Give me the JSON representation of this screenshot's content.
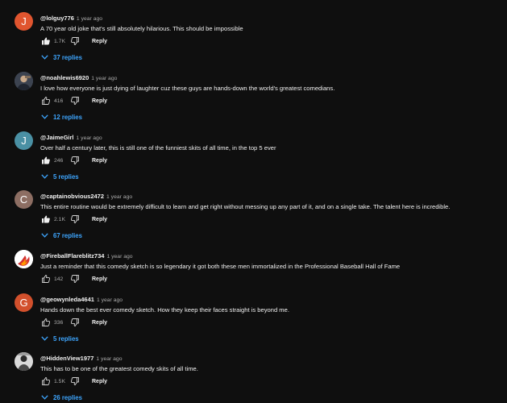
{
  "reply_label": "Reply",
  "colors": {
    "background": "#0f0f0f",
    "link": "#3ea6ff",
    "muted": "#aaaaaa"
  },
  "comments": [
    {
      "author": "@lolguy776",
      "time": "1 year ago",
      "text": "A 70 year old joke that's still absolutely hilarious. This should be impossible",
      "likes": "1.7K",
      "liked": true,
      "replies": "37 replies",
      "avatar_letter": "J",
      "avatar_color": "#e0552f"
    },
    {
      "author": "@noahlewis6920",
      "time": "1 year ago",
      "text": "I love how everyone is just dying of laughter cuz these guys are hands-down the world's greatest comedians.",
      "likes": "416",
      "liked": false,
      "replies": "12 replies",
      "avatar_letter": "",
      "avatar_color": "#4a4f5a"
    },
    {
      "author": "@JaimeGirl",
      "time": "1 year ago",
      "text": "Over half a century later, this is still one of the funniest skits of all time, in the top 5 ever",
      "likes": "246",
      "liked": true,
      "replies": "5 replies",
      "avatar_letter": "J",
      "avatar_color": "#4a90a4"
    },
    {
      "author": "@captainobvious2472",
      "time": "1 year ago",
      "text": "This entire routine would be extremely difficult to learn and get right without messing up any part of it, and on a single take. The talent here is incredible.",
      "likes": "2.1K",
      "liked": true,
      "replies": "67 replies",
      "avatar_letter": "C",
      "avatar_color": "#8d6e63"
    },
    {
      "author": "@FireballFlareblitz734",
      "time": "1 year ago",
      "text": "Just a reminder that this comedy sketch is so legendary it got both these men immortalized in the Professional Baseball Hall of Fame",
      "likes": "142",
      "liked": false,
      "replies": "",
      "avatar_letter": "",
      "avatar_color": "#ffffff"
    },
    {
      "author": "@geowynleda4641",
      "time": "1 year ago",
      "text": "Hands down the best ever comedy sketch.  How they keep their faces straight is beyond me.",
      "likes": "336",
      "liked": false,
      "replies": "5 replies",
      "avatar_letter": "G",
      "avatar_color": "#d2502c"
    },
    {
      "author": "@HiddenView1977",
      "time": "1 year ago",
      "text": "This has to be one of the greatest comedy skits of all time.",
      "likes": "1.5K",
      "liked": false,
      "replies": "26 replies",
      "avatar_letter": "",
      "avatar_color": "#6e6e6e"
    }
  ]
}
